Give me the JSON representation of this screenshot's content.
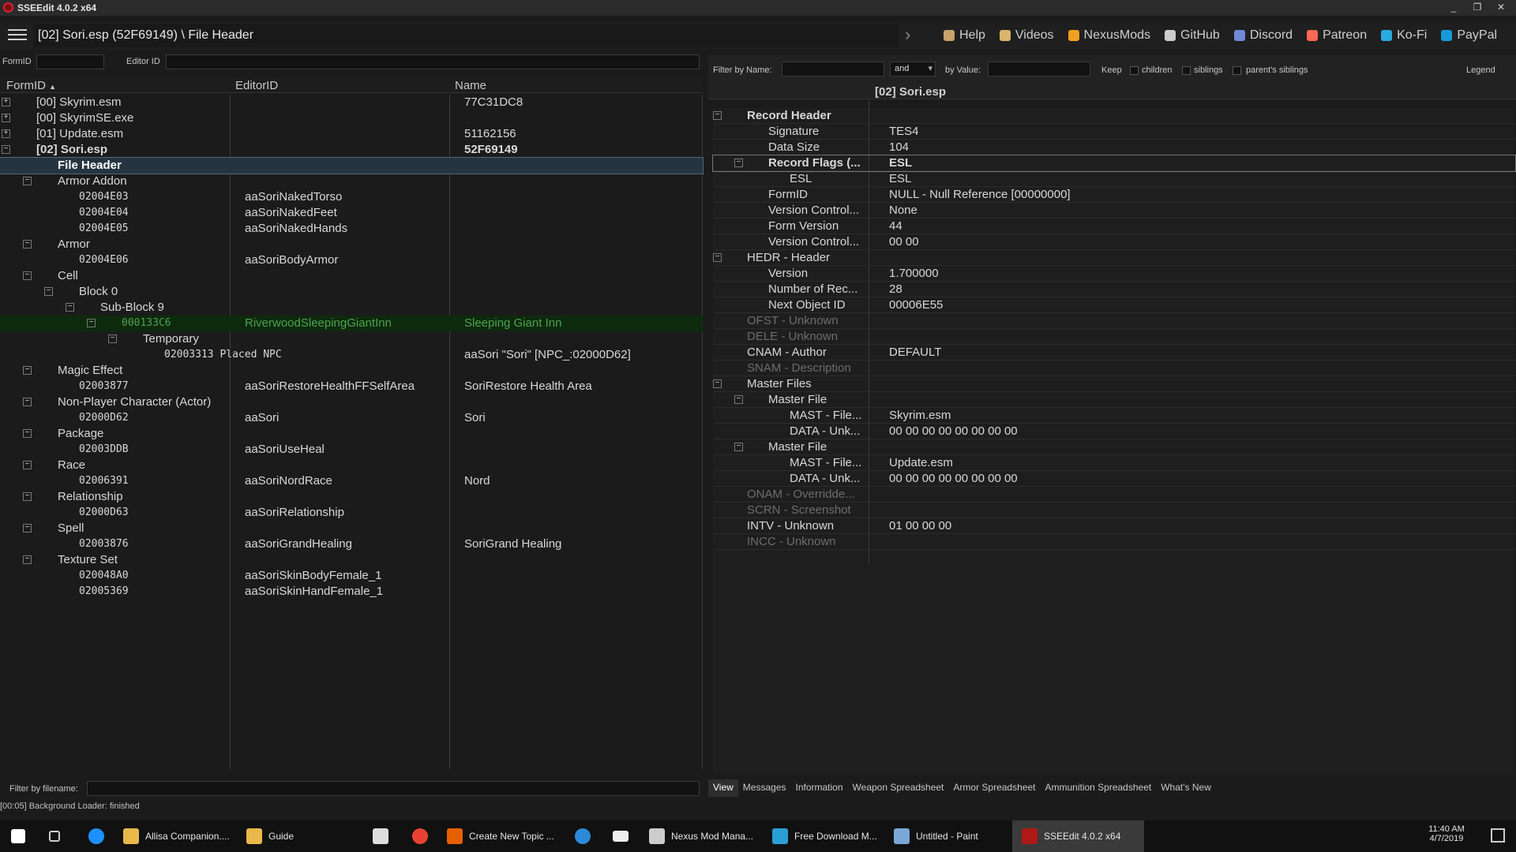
{
  "window": {
    "title": "SSEEdit 4.0.2 x64",
    "min": "_",
    "max": "❐",
    "close": "✕"
  },
  "nav": {
    "path": "[02] Sori.esp (52F69149) \\ File Header",
    "next": "›",
    "links": [
      {
        "label": "Help",
        "color": "#c9a26a",
        "icon": "book-icon"
      },
      {
        "label": "Videos",
        "color": "#d9b56b",
        "icon": "video-icon"
      },
      {
        "label": "NexusMods",
        "color": "#f0a020",
        "icon": "nexus-icon"
      },
      {
        "label": "GitHub",
        "color": "#cccccc",
        "icon": "github-icon"
      },
      {
        "label": "Discord",
        "color": "#7289da",
        "icon": "discord-icon"
      },
      {
        "label": "Patreon",
        "color": "#f96854",
        "icon": "patreon-icon"
      },
      {
        "label": "Ko-Fi",
        "color": "#29abe0",
        "icon": "kofi-icon"
      },
      {
        "label": "PayPal",
        "color": "#169bd7",
        "icon": "paypal-icon"
      }
    ]
  },
  "left_filter": {
    "formid_label": "FormID",
    "editorid_label": "Editor ID"
  },
  "right_filter": {
    "by_name": "Filter by Name:",
    "and": "and",
    "by_value": "by Value:",
    "keep": "Keep",
    "children": "children",
    "siblings": "siblings",
    "parents_siblings": "parent's siblings",
    "legend": "Legend"
  },
  "tree": {
    "headers": [
      "FormID",
      "EditorID",
      "Name"
    ],
    "sort_arrow": "▲",
    "rows": [
      {
        "lvl": 0,
        "exp": "+",
        "c1": "[00] Skyrim.esm",
        "c2": "",
        "c3": "77C31DC8",
        "bold": false
      },
      {
        "lvl": 0,
        "exp": "+",
        "c1": "[00] SkyrimSE.exe",
        "c2": "",
        "c3": "",
        "bold": false
      },
      {
        "lvl": 0,
        "exp": "+",
        "c1": "[01] Update.esm",
        "c2": "",
        "c3": "51162156",
        "bold": false
      },
      {
        "lvl": 0,
        "exp": "−",
        "c1": "[02] Sori.esp",
        "c2": "",
        "c3": "52F69149",
        "bold": true
      },
      {
        "lvl": 1,
        "exp": "",
        "c1": "File Header",
        "c2": "",
        "c3": "",
        "bold": true,
        "sel": true
      },
      {
        "lvl": 1,
        "exp": "−",
        "c1": "Armor Addon",
        "c2": "",
        "c3": ""
      },
      {
        "lvl": 2,
        "exp": "",
        "c1": "02004E03",
        "c2": "aaSoriNakedTorso",
        "c3": "",
        "mono": true
      },
      {
        "lvl": 2,
        "exp": "",
        "c1": "02004E04",
        "c2": "aaSoriNakedFeet",
        "c3": "",
        "mono": true
      },
      {
        "lvl": 2,
        "exp": "",
        "c1": "02004E05",
        "c2": "aaSoriNakedHands",
        "c3": "",
        "mono": true
      },
      {
        "lvl": 1,
        "exp": "−",
        "c1": "Armor",
        "c2": "",
        "c3": ""
      },
      {
        "lvl": 2,
        "exp": "",
        "c1": "02004E06",
        "c2": "aaSoriBodyArmor",
        "c3": "",
        "mono": true
      },
      {
        "lvl": 1,
        "exp": "−",
        "c1": "Cell",
        "c2": "",
        "c3": ""
      },
      {
        "lvl": 2,
        "exp": "−",
        "c1": "Block 0",
        "c2": "",
        "c3": ""
      },
      {
        "lvl": 3,
        "exp": "−",
        "c1": "Sub-Block 9",
        "c2": "",
        "c3": ""
      },
      {
        "lvl": 4,
        "exp": "−",
        "c1": "000133C6",
        "c2": "RiverwoodSleepingGiantInn",
        "c3": "Sleeping Giant Inn",
        "mono": true,
        "green": true
      },
      {
        "lvl": 5,
        "exp": "−",
        "c1": "Temporary",
        "c2": "",
        "c3": ""
      },
      {
        "lvl": 6,
        "exp": "",
        "c1": "02003313  Placed NPC",
        "c2": "",
        "c3": "aaSori \"Sori\" [NPC_:02000D62]",
        "mono": true
      },
      {
        "lvl": 1,
        "exp": "−",
        "c1": "Magic Effect",
        "c2": "",
        "c3": ""
      },
      {
        "lvl": 2,
        "exp": "",
        "c1": "02003877",
        "c2": "aaSoriRestoreHealthFFSelfArea",
        "c3": "SoriRestore Health Area",
        "mono": true
      },
      {
        "lvl": 1,
        "exp": "−",
        "c1": "Non-Player Character (Actor)",
        "c2": "",
        "c3": ""
      },
      {
        "lvl": 2,
        "exp": "",
        "c1": "02000D62",
        "c2": "aaSori",
        "c3": "Sori",
        "mono": true
      },
      {
        "lvl": 1,
        "exp": "−",
        "c1": "Package",
        "c2": "",
        "c3": ""
      },
      {
        "lvl": 2,
        "exp": "",
        "c1": "02003DDB",
        "c2": "aaSoriUseHeal",
        "c3": "",
        "mono": true
      },
      {
        "lvl": 1,
        "exp": "−",
        "c1": "Race",
        "c2": "",
        "c3": ""
      },
      {
        "lvl": 2,
        "exp": "",
        "c1": "02006391",
        "c2": "aaSoriNordRace",
        "c3": "Nord",
        "mono": true
      },
      {
        "lvl": 1,
        "exp": "−",
        "c1": "Relationship",
        "c2": "",
        "c3": ""
      },
      {
        "lvl": 2,
        "exp": "",
        "c1": "02000D63",
        "c2": "aaSoriRelationship",
        "c3": "",
        "mono": true
      },
      {
        "lvl": 1,
        "exp": "−",
        "c1": "Spell",
        "c2": "",
        "c3": ""
      },
      {
        "lvl": 2,
        "exp": "",
        "c1": "02003876",
        "c2": "aaSoriGrandHealing",
        "c3": "SoriGrand Healing",
        "mono": true
      },
      {
        "lvl": 1,
        "exp": "−",
        "c1": "Texture Set",
        "c2": "",
        "c3": ""
      },
      {
        "lvl": 2,
        "exp": "",
        "c1": "020048A0",
        "c2": "aaSoriSkinBodyFemale_1",
        "c3": "",
        "mono": true
      },
      {
        "lvl": 2,
        "exp": "",
        "c1": "02005369",
        "c2": "aaSoriSkinHandFemale_1",
        "c3": "",
        "mono": true
      }
    ]
  },
  "filter_filename": "Filter by filename:",
  "record": {
    "header": "[02] Sori.esp",
    "rows": [
      {
        "lvl": 0,
        "exp": "−",
        "k": "Record Header",
        "v": "",
        "bold": true
      },
      {
        "lvl": 1,
        "k": "Signature",
        "v": "TES4"
      },
      {
        "lvl": 1,
        "k": "Data Size",
        "v": "104"
      },
      {
        "lvl": 1,
        "exp": "−",
        "k": "Record Flags (...",
        "v": "ESL",
        "bold": true,
        "sel": true
      },
      {
        "lvl": 2,
        "k": "ESL",
        "v": "ESL"
      },
      {
        "lvl": 1,
        "k": "FormID",
        "v": "NULL - Null Reference [00000000]"
      },
      {
        "lvl": 1,
        "k": "Version Control...",
        "v": "None"
      },
      {
        "lvl": 1,
        "k": "Form Version",
        "v": "44"
      },
      {
        "lvl": 1,
        "k": "Version Control...",
        "v": "00 00"
      },
      {
        "lvl": 0,
        "exp": "−",
        "k": "HEDR - Header",
        "v": ""
      },
      {
        "lvl": 1,
        "k": "Version",
        "v": "1.700000"
      },
      {
        "lvl": 1,
        "k": "Number of Rec...",
        "v": "28"
      },
      {
        "lvl": 1,
        "k": "Next Object ID",
        "v": "00006E55"
      },
      {
        "lvl": 0,
        "k": "OFST - Unknown",
        "v": "",
        "gray": true
      },
      {
        "lvl": 0,
        "k": "DELE - Unknown",
        "v": "",
        "gray": true
      },
      {
        "lvl": 0,
        "k": "CNAM - Author",
        "v": "DEFAULT"
      },
      {
        "lvl": 0,
        "k": "SNAM - Description",
        "v": "",
        "gray": true
      },
      {
        "lvl": 0,
        "exp": "−",
        "k": "Master Files",
        "v": ""
      },
      {
        "lvl": 1,
        "exp": "−",
        "k": "Master File",
        "v": ""
      },
      {
        "lvl": 2,
        "k": "MAST - File...",
        "v": "Skyrim.esm"
      },
      {
        "lvl": 2,
        "k": "DATA - Unk...",
        "v": "00 00 00 00 00 00 00 00"
      },
      {
        "lvl": 1,
        "exp": "−",
        "k": "Master File",
        "v": ""
      },
      {
        "lvl": 2,
        "k": "MAST - File...",
        "v": "Update.esm"
      },
      {
        "lvl": 2,
        "k": "DATA - Unk...",
        "v": "00 00 00 00 00 00 00 00"
      },
      {
        "lvl": 0,
        "k": "ONAM - Overridde...",
        "v": "",
        "gray": true
      },
      {
        "lvl": 0,
        "k": "SCRN - Screenshot",
        "v": "",
        "gray": true
      },
      {
        "lvl": 0,
        "k": "INTV - Unknown",
        "v": "01 00 00 00"
      },
      {
        "lvl": 0,
        "k": "INCC - Unknown",
        "v": "",
        "gray": true
      }
    ]
  },
  "tabs": [
    "View",
    "Messages",
    "Information",
    "Weapon Spreadsheet",
    "Armor Spreadsheet",
    "Ammunition Spreadsheet",
    "What's New"
  ],
  "status": "[00:05] Background Loader: finished",
  "taskbar": {
    "items": [
      {
        "label": "Allisa Companion....",
        "color": "#e8b84a",
        "icon": "folder-icon"
      },
      {
        "label": "Guide",
        "color": "#e8b84a",
        "icon": "folder-icon"
      },
      {
        "label": "Create New Topic ...",
        "color": "#e66000",
        "icon": "firefox-icon"
      },
      {
        "label": "Nexus Mod Mana...",
        "color": "#cccccc",
        "icon": "nmm-icon"
      },
      {
        "label": "Free Download M...",
        "color": "#2a9fd6",
        "icon": "fdm-icon"
      },
      {
        "label": "Untitled - Paint",
        "color": "#7aa7d8",
        "icon": "paint-icon"
      },
      {
        "label": "SSEEdit 4.0.2 x64",
        "color": "#b01818",
        "icon": "sseedit-icon"
      }
    ],
    "time": "11:40 AM",
    "date": "4/7/2019"
  }
}
